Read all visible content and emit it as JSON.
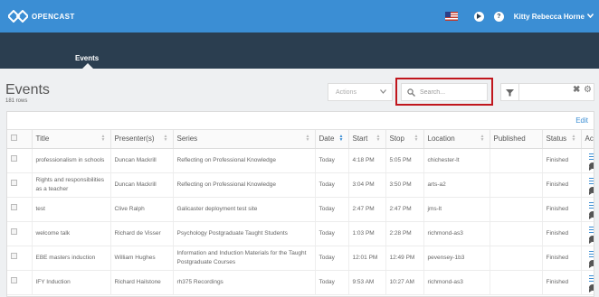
{
  "app": {
    "name": "OPENCAST"
  },
  "header": {
    "user_name": "Kitty Rebecca Horne",
    "flag_icon": "us-flag-icon",
    "play_icon": "play-icon",
    "help_icon": "help-icon",
    "help_glyph": "?"
  },
  "nav": {
    "tabs": [
      {
        "label": "Events",
        "active": true
      }
    ]
  },
  "page": {
    "title": "Events",
    "row_count": "181 rows"
  },
  "toolbar": {
    "actions_label": "Actions",
    "search_placeholder": "Search...",
    "filter_icon": "funnel-icon",
    "clear_glyph": "✖",
    "settings_glyph": "⚙"
  },
  "table": {
    "edit_label": "Edit",
    "columns": [
      {
        "key": "select",
        "label": ""
      },
      {
        "key": "title",
        "label": "Title"
      },
      {
        "key": "presenters",
        "label": "Presenter(s)"
      },
      {
        "key": "series",
        "label": "Series"
      },
      {
        "key": "date",
        "label": "Date"
      },
      {
        "key": "start",
        "label": "Start"
      },
      {
        "key": "stop",
        "label": "Stop"
      },
      {
        "key": "location",
        "label": "Location"
      },
      {
        "key": "published",
        "label": "Published"
      },
      {
        "key": "status",
        "label": "Status"
      },
      {
        "key": "actions",
        "label": "Actions"
      }
    ],
    "rows": [
      {
        "title": "professionalism in schools",
        "presenters": "Duncan Mackrill",
        "series": "Reflecting on Professional Knowledge",
        "date": "Today",
        "start": "4:18 PM",
        "stop": "5:05 PM",
        "location": "chichester-lt",
        "published": "",
        "status": "Finished"
      },
      {
        "title": "Rights and responsibilities as a teacher",
        "presenters": "Duncan Mackrill",
        "series": "Reflecting on Professional Knowledge",
        "date": "Today",
        "start": "3:04 PM",
        "stop": "3:50 PM",
        "location": "arts-a2",
        "published": "",
        "status": "Finished"
      },
      {
        "title": "test",
        "presenters": "Clive Ralph",
        "series": "Galicaster deployment test site",
        "date": "Today",
        "start": "2:47 PM",
        "stop": "2:47 PM",
        "location": "jms-lt",
        "published": "",
        "status": "Finished"
      },
      {
        "title": "welcome talk",
        "presenters": "Richard de Visser",
        "series": "Psychology Postgraduate Taught Students",
        "date": "Today",
        "start": "1:03 PM",
        "stop": "2:28 PM",
        "location": "richmond-as3",
        "published": "",
        "status": "Finished"
      },
      {
        "title": "EBE masters induction",
        "presenters": "William Hughes",
        "series": "Information and Induction Materials for the Taught Postgraduate Courses",
        "date": "Today",
        "start": "12:01 PM",
        "stop": "12:49 PM",
        "location": "pevensey-1b3",
        "published": "",
        "status": "Finished"
      },
      {
        "title": "IFY Induction",
        "presenters": "Richard Hailstone",
        "series": "rh375 Recordings",
        "date": "Today",
        "start": "9:53 AM",
        "stop": "10:27 AM",
        "location": "richmond-as3",
        "published": "",
        "status": "Finished"
      }
    ]
  },
  "colors": {
    "topbar": "#3b8ed4",
    "navband": "#2b3e50",
    "highlight": "#c0161d",
    "accent": "#3b8ed4"
  }
}
